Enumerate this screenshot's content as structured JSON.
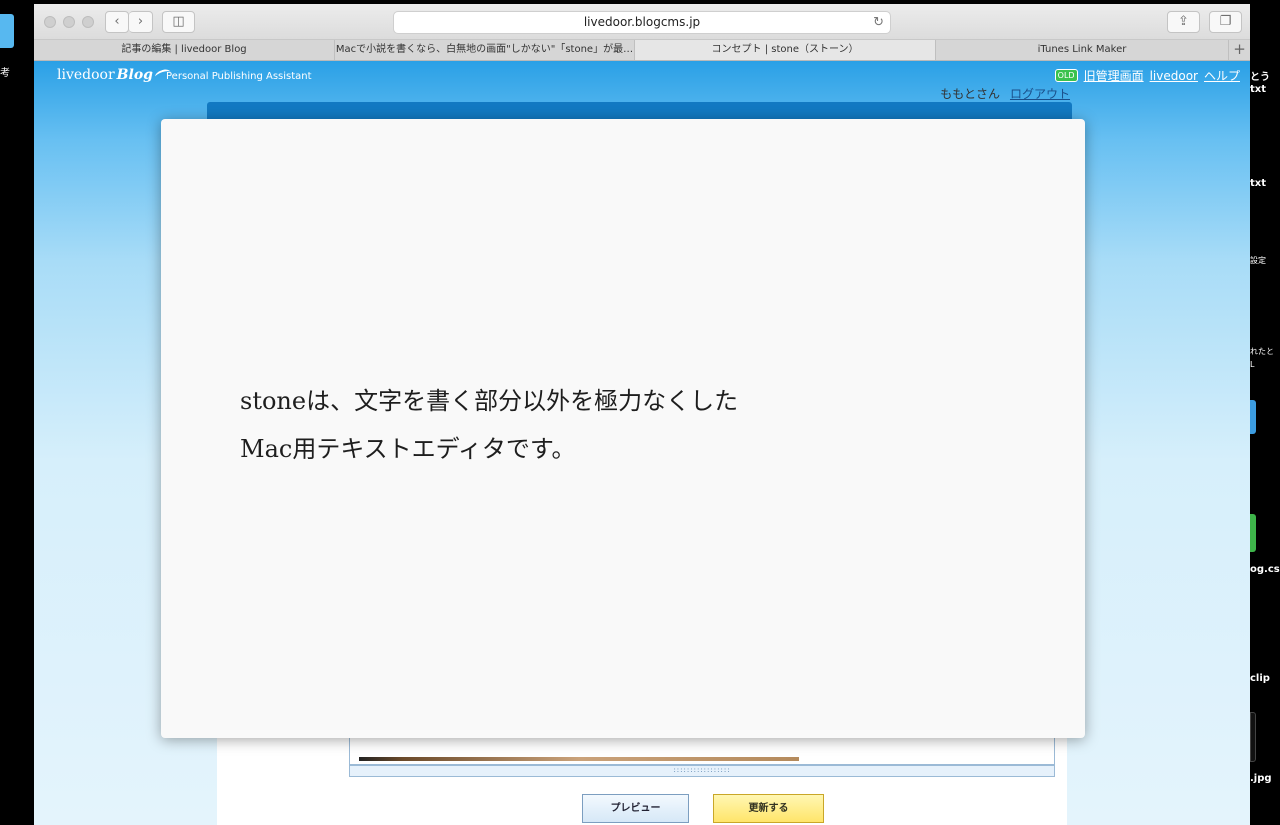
{
  "desktop": {
    "left_label": "考",
    "right_labels": [
      "とう",
      "txt",
      "txt",
      "設定",
      "れたと",
      "L",
      "og.css",
      "clip",
      ".jpg"
    ]
  },
  "browser": {
    "url": "livedoor.blogcms.jp",
    "tabs": [
      {
        "label": "記事の編集 | livedoor Blog",
        "active": false
      },
      {
        "label": "Macで小説を書くなら、白無地の画面\"しかない\"「stone」が最…",
        "active": false
      },
      {
        "label": "コンセプト | stone（ストーン）",
        "active": true
      },
      {
        "label": "iTunes Link Maker",
        "active": false
      }
    ],
    "add_tab": "+"
  },
  "site": {
    "logo_text": "livedoor",
    "logo_blog": "Blog",
    "tagline": "Personal Publishing Assistant",
    "old_badge": "OLD",
    "links": {
      "old_admin": "旧管理画面",
      "livedoor": "livedoor",
      "help": "ヘルプ"
    },
    "user_name": "ももとさん",
    "logout": "ログアウト"
  },
  "editor": {
    "preview_button": "プレビュー",
    "update_button": "更新する",
    "resize_grip": ":::::::::::::::::"
  },
  "modal": {
    "line1": "stoneは、文字を書く部分以外を極力なくした",
    "line2": "Mac用テキストエディタです。"
  },
  "colors": {
    "accent_blue": "#1279c2",
    "update_yellow": "#ffe56a",
    "old_badge_green": "#3ac24e"
  }
}
